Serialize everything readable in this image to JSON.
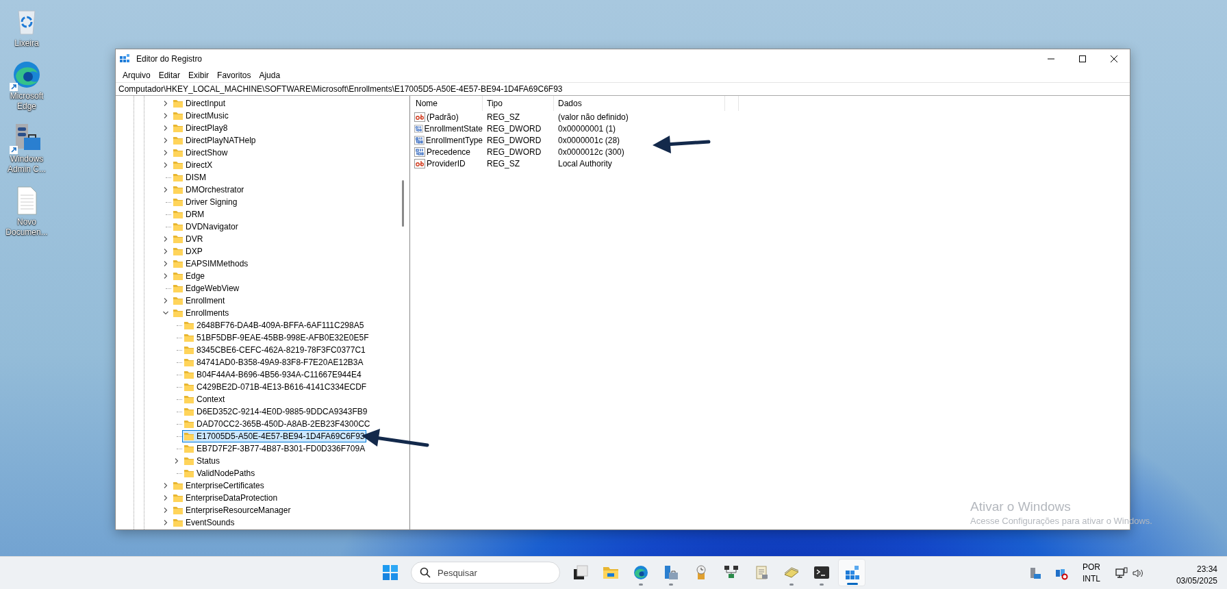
{
  "desktop_icons": [
    {
      "kind": "recycle",
      "label": "Lixeira",
      "shortcut": false
    },
    {
      "kind": "edge",
      "label": "Microsoft Edge",
      "shortcut": true
    },
    {
      "kind": "admin",
      "label": "Windows Admin C...",
      "shortcut": true
    },
    {
      "kind": "document",
      "label": "Novo Documen...",
      "shortcut": false
    }
  ],
  "window": {
    "title": "Editor do Registro",
    "menu": [
      "Arquivo",
      "Editar",
      "Exibir",
      "Favoritos",
      "Ajuda"
    ],
    "address": "Computador\\HKEY_LOCAL_MACHINE\\SOFTWARE\\Microsoft\\Enrollments\\E17005D5-A50E-4E57-BE94-1D4FA69C6F93"
  },
  "tree": [
    {
      "kind": "branch",
      "label": "DirectInput",
      "expanded": false,
      "selected": false
    },
    {
      "kind": "branch",
      "label": "DirectMusic",
      "expanded": false,
      "selected": false
    },
    {
      "kind": "branch",
      "label": "DirectPlay8",
      "expanded": false,
      "selected": false
    },
    {
      "kind": "branch",
      "label": "DirectPlayNATHelp",
      "expanded": false,
      "selected": false
    },
    {
      "kind": "branch",
      "label": "DirectShow",
      "expanded": false,
      "selected": false
    },
    {
      "kind": "branch",
      "label": "DirectX",
      "expanded": false,
      "selected": false
    },
    {
      "kind": "leaf",
      "label": "DISM",
      "selected": false
    },
    {
      "kind": "branch",
      "label": "DMOrchestrator",
      "expanded": false,
      "selected": false
    },
    {
      "kind": "leaf",
      "label": "Driver Signing",
      "selected": false
    },
    {
      "kind": "leaf",
      "label": "DRM",
      "selected": false
    },
    {
      "kind": "leaf",
      "label": "DVDNavigator",
      "selected": false
    },
    {
      "kind": "branch",
      "label": "DVR",
      "expanded": false,
      "selected": false
    },
    {
      "kind": "branch",
      "label": "DXP",
      "expanded": false,
      "selected": false
    },
    {
      "kind": "branch",
      "label": "EAPSIMMethods",
      "expanded": false,
      "selected": false
    },
    {
      "kind": "branch",
      "label": "Edge",
      "expanded": false,
      "selected": false
    },
    {
      "kind": "leaf",
      "label": "EdgeWebView",
      "selected": false
    },
    {
      "kind": "branch",
      "label": "Enrollment",
      "expanded": false,
      "selected": false
    },
    {
      "kind": "branch",
      "label": "Enrollments",
      "expanded": true,
      "selected": false,
      "children": [
        {
          "kind": "leaf",
          "label": "2648BF76-DA4B-409A-BFFA-6AF111C298A5",
          "selected": false
        },
        {
          "kind": "leaf",
          "label": "51BF5DBF-9EAE-45BB-998E-AFB0E32E0E5F",
          "selected": false
        },
        {
          "kind": "leaf",
          "label": "8345CBE6-CEFC-462A-8219-78F3FC0377C1",
          "selected": false
        },
        {
          "kind": "leaf",
          "label": "84741AD0-B358-49A9-83F8-F7E20AE12B3A",
          "selected": false
        },
        {
          "kind": "leaf",
          "label": "B04F44A4-B696-4B56-934A-C11667E944E4",
          "selected": false
        },
        {
          "kind": "leaf",
          "label": "C429BE2D-071B-4E13-B616-4141C334ECDF",
          "selected": false
        },
        {
          "kind": "leaf",
          "label": "Context",
          "selected": false
        },
        {
          "kind": "leaf",
          "label": "D6ED352C-9214-4E0D-9885-9DDCA9343FB9",
          "selected": false
        },
        {
          "kind": "leaf",
          "label": "DAD70CC2-365B-450D-A8AB-2EB23F4300CC",
          "selected": false
        },
        {
          "kind": "leaf",
          "label": "E17005D5-A50E-4E57-BE94-1D4FA69C6F93",
          "selected": true
        },
        {
          "kind": "leaf",
          "label": "EB7D7F2F-3B77-4B87-B301-FD0D336F709A",
          "selected": false
        },
        {
          "kind": "branch",
          "label": "Status",
          "expanded": false,
          "selected": false
        },
        {
          "kind": "leaf",
          "label": "ValidNodePaths",
          "selected": false
        }
      ]
    },
    {
      "kind": "branch",
      "label": "EnterpriseCertificates",
      "expanded": false,
      "selected": false
    },
    {
      "kind": "branch",
      "label": "EnterpriseDataProtection",
      "expanded": false,
      "selected": false
    },
    {
      "kind": "branch",
      "label": "EnterpriseResourceManager",
      "expanded": false,
      "selected": false
    },
    {
      "kind": "branch",
      "label": "EventSounds",
      "expanded": false,
      "selected": false
    }
  ],
  "values": {
    "columns": [
      "Nome",
      "Tipo",
      "Dados"
    ],
    "rows": [
      {
        "kind": "string",
        "name": "(Padrão)",
        "type": "REG_SZ",
        "data": "(valor não definido)"
      },
      {
        "kind": "binary",
        "name": "EnrollmentState",
        "type": "REG_DWORD",
        "data": "0x00000001 (1)"
      },
      {
        "kind": "binary",
        "name": "EnrollmentType",
        "type": "REG_DWORD",
        "data": "0x0000001c (28)"
      },
      {
        "kind": "binary",
        "name": "Precedence",
        "type": "REG_DWORD",
        "data": "0x0000012c (300)"
      },
      {
        "kind": "string",
        "name": "ProviderID",
        "type": "REG_SZ",
        "data": "Local Authority"
      }
    ]
  },
  "activation": {
    "title": "Ativar o Windows",
    "text": "Acesse Configurações para ativar o Windows."
  },
  "taskbar": {
    "search": {
      "placeholder": "Pesquisar"
    },
    "apps": [
      {
        "kind": "taskview",
        "running": false,
        "active": false
      },
      {
        "kind": "folder",
        "running": false,
        "active": false
      },
      {
        "kind": "edge",
        "running": true,
        "active": false
      },
      {
        "kind": "server",
        "running": true,
        "active": false
      },
      {
        "kind": "clock",
        "running": false,
        "active": false
      },
      {
        "kind": "network",
        "running": false,
        "active": false
      },
      {
        "kind": "scroll",
        "running": false,
        "active": false
      },
      {
        "kind": "cards",
        "running": true,
        "active": false
      },
      {
        "kind": "terminal",
        "running": true,
        "active": false
      },
      {
        "kind": "registry",
        "running": true,
        "active": true
      }
    ],
    "tray": {
      "language": "POR",
      "layout": "INTL",
      "time": "23:34",
      "date": "03/05/2025"
    }
  }
}
